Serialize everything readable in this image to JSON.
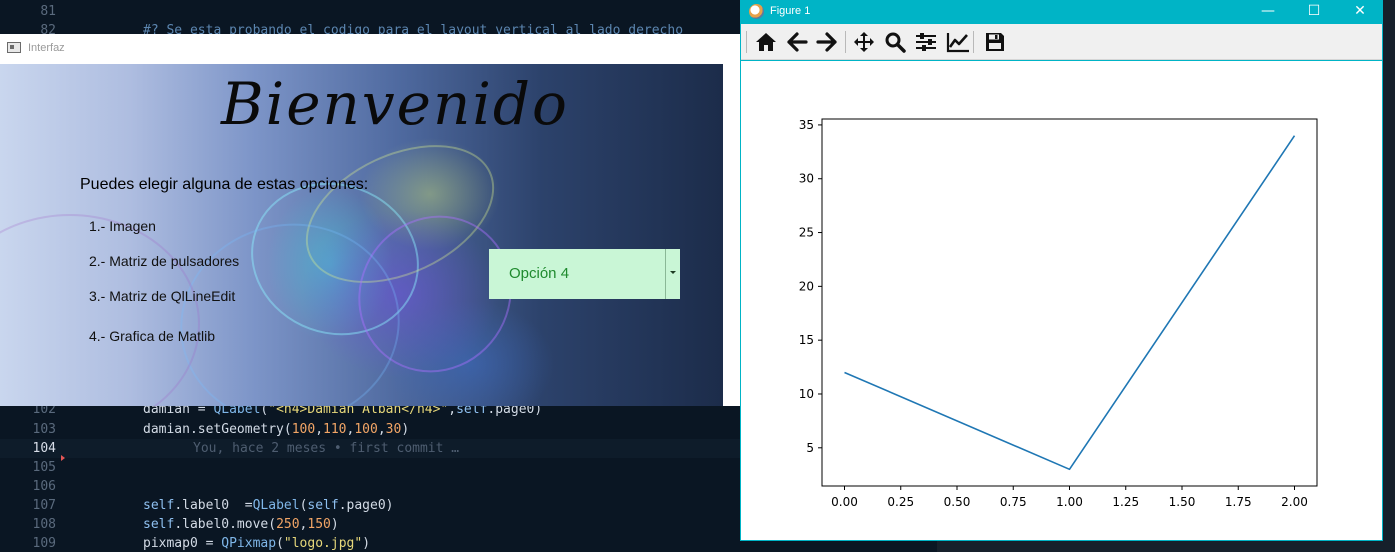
{
  "editor": {
    "lines": [
      {
        "n": "81",
        "segments": []
      },
      {
        "n": "82",
        "segments": [
          {
            "t": "#? Se esta probando el codigo para el layout vertical al lado derecho",
            "c": "tok-cm"
          }
        ]
      },
      {
        "n": "102",
        "segments": [
          {
            "t": "damian = ",
            "c": "tok-id"
          },
          {
            "t": "QLabel",
            "c": "tok-cls"
          },
          {
            "t": "(",
            "c": "tok-id"
          },
          {
            "t": "\"<h4>Damian Alban</h4>\"",
            "c": "tok-str"
          },
          {
            "t": ",",
            "c": "tok-id"
          },
          {
            "t": "self",
            "c": "tok-kw"
          },
          {
            "t": ".page0)",
            "c": "tok-id"
          }
        ]
      },
      {
        "n": "103",
        "segments": [
          {
            "t": "damian.setGeometry(",
            "c": "tok-id"
          },
          {
            "t": "100",
            "c": "tok-num"
          },
          {
            "t": ",",
            "c": "tok-id"
          },
          {
            "t": "110",
            "c": "tok-num"
          },
          {
            "t": ",",
            "c": "tok-id"
          },
          {
            "t": "100",
            "c": "tok-num"
          },
          {
            "t": ",",
            "c": "tok-id"
          },
          {
            "t": "30",
            "c": "tok-num"
          },
          {
            "t": ")",
            "c": "tok-id"
          }
        ]
      },
      {
        "n": "104",
        "segments": [],
        "blame": "You, hace 2 meses • first commit …"
      },
      {
        "n": "105",
        "segments": []
      },
      {
        "n": "106",
        "segments": []
      },
      {
        "n": "107",
        "segments": [
          {
            "t": "self",
            "c": "tok-kw"
          },
          {
            "t": ".label0  =",
            "c": "tok-id"
          },
          {
            "t": "QLabel",
            "c": "tok-cls"
          },
          {
            "t": "(",
            "c": "tok-id"
          },
          {
            "t": "self",
            "c": "tok-kw"
          },
          {
            "t": ".page0)",
            "c": "tok-id"
          }
        ]
      },
      {
        "n": "108",
        "segments": [
          {
            "t": "self",
            "c": "tok-kw"
          },
          {
            "t": ".label0.move(",
            "c": "tok-id"
          },
          {
            "t": "250",
            "c": "tok-num"
          },
          {
            "t": ",",
            "c": "tok-id"
          },
          {
            "t": "150",
            "c": "tok-num"
          },
          {
            "t": ")",
            "c": "tok-id"
          }
        ]
      },
      {
        "n": "109",
        "segments": [
          {
            "t": "pixmap0 = ",
            "c": "tok-id"
          },
          {
            "t": "QPixmap",
            "c": "tok-cls"
          },
          {
            "t": "(",
            "c": "tok-id"
          },
          {
            "t": "\"logo.jpg\"",
            "c": "tok-str"
          },
          {
            "t": ")",
            "c": "tok-id"
          }
        ]
      }
    ],
    "active_line": "104"
  },
  "interfaz": {
    "title": "Interfaz",
    "welcome": "Bienvenido",
    "prompt": "Puedes elegir alguna de estas opciones:",
    "options": [
      "1.- Imagen",
      "2.- Matriz de pulsadores",
      "3.-  Matriz de QlLineEdit",
      "4.- Grafica de Matlib"
    ],
    "combo_value": "Opción 4"
  },
  "figure": {
    "title": "Figure 1",
    "window_buttons": {
      "minimize": "—",
      "maximize": "☐",
      "close": "✕"
    },
    "toolbar_icons": [
      "home-icon",
      "back-icon",
      "forward-icon",
      "pan-icon",
      "zoom-icon",
      "configure-subplots-icon",
      "edit-axis-icon",
      "save-icon"
    ]
  },
  "chart_data": {
    "type": "line",
    "title": "",
    "xlabel": "",
    "ylabel": "",
    "x": [
      0,
      1,
      2
    ],
    "series": [
      {
        "values": [
          12,
          3,
          34
        ],
        "color": "#1f77b4"
      }
    ],
    "xlim": [
      -0.1,
      2.1
    ],
    "ylim": [
      1.45,
      35.55
    ],
    "xticks": [
      "0.00",
      "0.25",
      "0.50",
      "0.75",
      "1.00",
      "1.25",
      "1.50",
      "1.75",
      "2.00"
    ],
    "yticks": [
      "5",
      "10",
      "15",
      "20",
      "25",
      "30",
      "35"
    ],
    "grid": false
  }
}
